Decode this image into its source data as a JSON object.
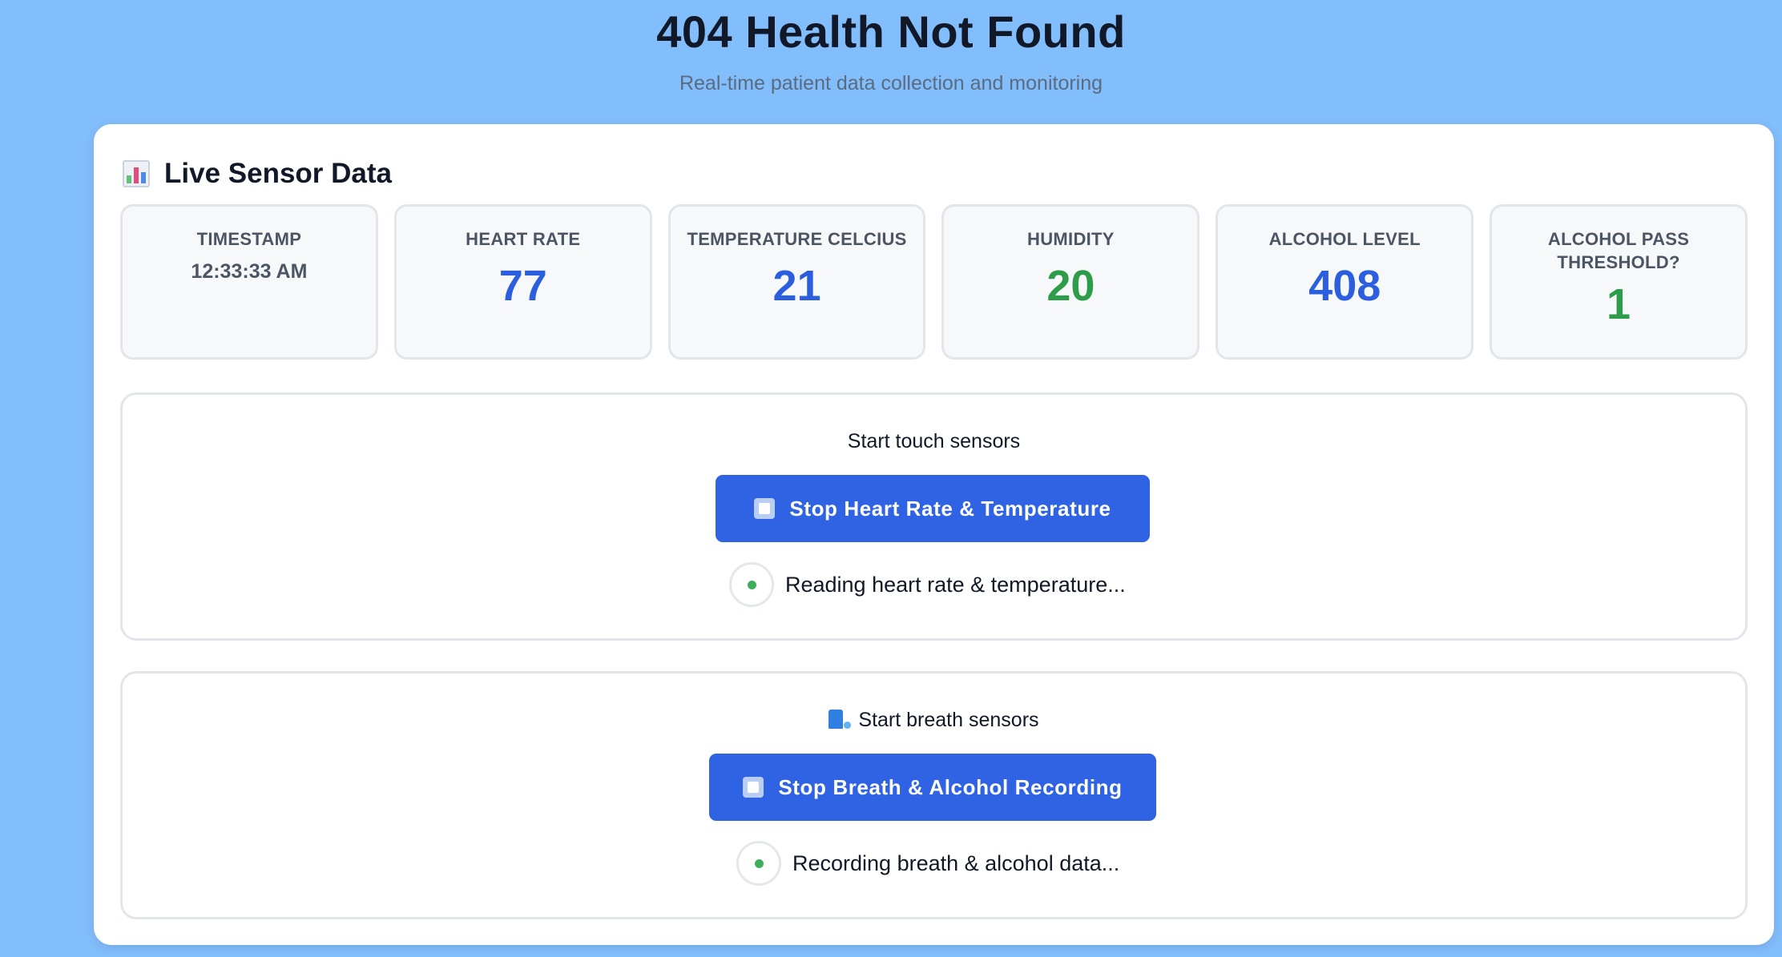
{
  "header": {
    "title": "404 Health Not Found",
    "subtitle": "Real-time patient data collection and monitoring"
  },
  "live_data": {
    "title": "Live Sensor Data",
    "icon": "bar-chart-icon",
    "metrics": [
      {
        "label": "TIMESTAMP",
        "value": "12:33:33 AM"
      },
      {
        "label": "HEART RATE",
        "value": "77",
        "color": "#2c5fe0"
      },
      {
        "label": "TEMPERATURE CELCIUS",
        "value": "21",
        "color": "#2c5fe0"
      },
      {
        "label": "HUMIDITY",
        "value": "20",
        "color": "#2e9d4a"
      },
      {
        "label": "ALCOHOL LEVEL",
        "value": "408",
        "color": "#2c5fe0"
      },
      {
        "label": "ALCOHOL PASS THRESHOLD?",
        "value": "1",
        "color": "#2e9d4a"
      }
    ]
  },
  "touch_sensors": {
    "heading": "Start touch sensors",
    "button_label": "Stop Heart Rate & Temperature",
    "button_icon": "stop-icon",
    "status": "Reading heart rate & temperature..."
  },
  "breath_sensors": {
    "heading": "Start breath sensors",
    "heading_icon": "breath-sensor-icon",
    "button_label": "Stop Breath & Alcohol Recording",
    "button_icon": "stop-icon",
    "status": "Recording breath & alcohol data..."
  },
  "colors": {
    "background": "#82bdfc",
    "accent_blue": "#2f63e3",
    "value_blue": "#2c5fe0",
    "value_green": "#2e9d4a",
    "status_green": "#3fae5c"
  }
}
